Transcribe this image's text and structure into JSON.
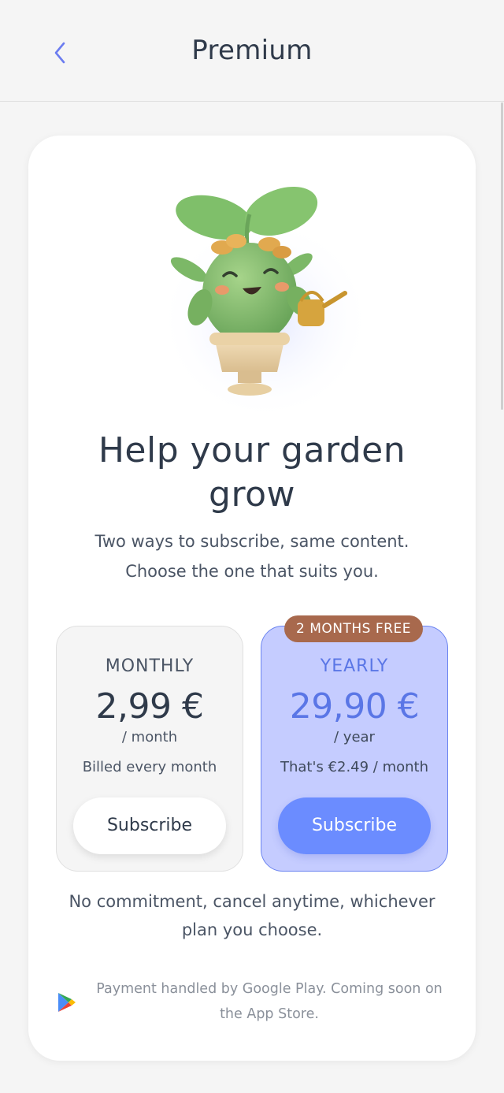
{
  "header": {
    "title": "Premium",
    "back_icon": "chevron-left-icon"
  },
  "hero": {
    "illustration": "plant-mascot-with-watering-can",
    "headline": "Help your garden grow",
    "subtitle_line1": "Two ways to subscribe, same content.",
    "subtitle_line2": "Choose the one that suits you."
  },
  "plans": [
    {
      "name": "MONTHLY",
      "price": "2,99 €",
      "period": "/ month",
      "note": "Billed every month",
      "button_label": "Subscribe"
    },
    {
      "name": "YEARLY",
      "price": "29,90 €",
      "period": "/ year",
      "note": "That's €2.49 / month",
      "button_label": "Subscribe",
      "badge": "2 MONTHS FREE"
    }
  ],
  "commitment_line1": "No commitment, cancel anytime, whichever",
  "commitment_line2": "plan you choose.",
  "payment": {
    "icon": "google-play-icon",
    "line1": "Payment handled by Google Play. Coming soon on",
    "line2": "the App Store."
  },
  "colors": {
    "accent": "#6b8cff",
    "accent_text": "#5a76e6",
    "yearly_bg": "#c5ccff",
    "badge": "#a8694d",
    "back_arrow": "#6b7cf0"
  }
}
